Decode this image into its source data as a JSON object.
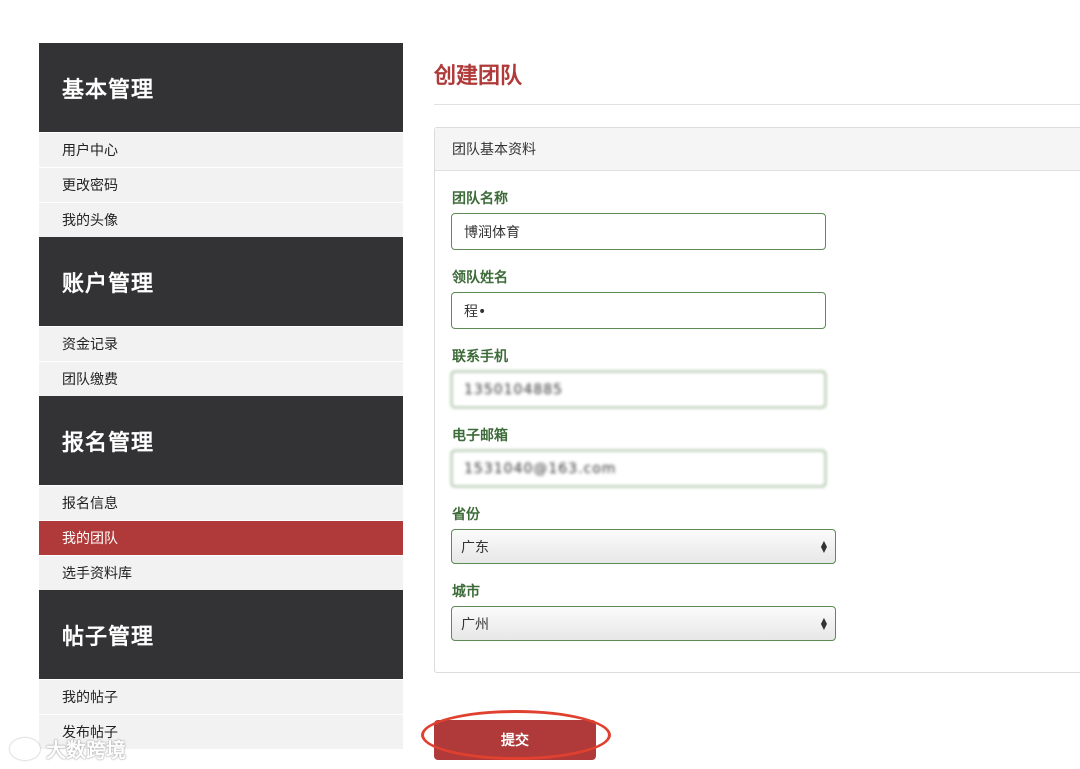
{
  "sidebar": {
    "sections": [
      {
        "title": "基本管理",
        "items": [
          "用户中心",
          "更改密码",
          "我的头像"
        ]
      },
      {
        "title": "账户管理",
        "items": [
          "资金记录",
          "团队缴费"
        ]
      },
      {
        "title": "报名管理",
        "items": [
          "报名信息",
          "我的团队",
          "选手资料库"
        ]
      },
      {
        "title": "帖子管理",
        "items": [
          "我的帖子",
          "发布帖子"
        ]
      }
    ],
    "active_item": "我的团队"
  },
  "main": {
    "page_title": "创建团队",
    "panel_title": "团队基本资料",
    "fields": {
      "team_name": {
        "label": "团队名称",
        "value": "博润体育"
      },
      "leader_name": {
        "label": "领队姓名",
        "value": "程•"
      },
      "phone": {
        "label": "联系手机",
        "value": "1350104885"
      },
      "email": {
        "label": "电子邮箱",
        "value": "1531040@163.com"
      },
      "province": {
        "label": "省份",
        "value": "广东"
      },
      "city": {
        "label": "城市",
        "value": "广州"
      }
    },
    "submit_label": "提交"
  },
  "watermark": "大数跨境",
  "colors": {
    "accent": "#b03a3a",
    "sidebar_dark": "#333235",
    "label_green": "#3d6b39",
    "highlight_circle": "#e0412f"
  }
}
